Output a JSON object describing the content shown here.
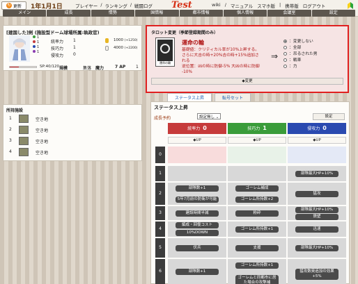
{
  "header": {
    "refresh_label": "更新",
    "date": "1年1月1日",
    "nav_left": [
      "プレイヤー",
      "/",
      "ランキング",
      "/",
      "戦闘ログ"
    ],
    "logo": "Test",
    "nav_right": [
      "wiki",
      "/",
      "マニュアル",
      "スマホ版",
      "|",
      "携帯版",
      "ログアウト"
    ],
    "tabs": [
      "メイン",
      "成長",
      "情勢",
      "国情報",
      "都市情報",
      "個人情報",
      "会議室",
      "設定"
    ]
  },
  "status": {
    "title": "[建国した]剣 (施設型ドーム球場所属:執政官)",
    "orbs": [
      "1",
      "1",
      "1",
      "1"
    ],
    "stats": [
      {
        "label": "統率力",
        "value": "1"
      },
      {
        "label": "技巧力",
        "value": "1"
      },
      {
        "label": "侵攻力",
        "value": "0"
      }
    ],
    "resources": [
      {
        "value": "1000",
        "max": "(+1250)"
      },
      {
        "value": "4000",
        "max": "(+2200)"
      }
    ],
    "sp_text": "SP:40/120",
    "sp_fill": 0.33,
    "bottom": [
      "規模",
      "集落",
      "魔力",
      "7 AP",
      "1"
    ]
  },
  "tarot": {
    "title": "タロット変更（季節登録期間のみ）",
    "card_caption": "運命の輪",
    "name": "運命の輪",
    "desc_lines": [
      "基礎値：クリティカル率が10%上昇する。",
      "さらに大吉の時+20%吉の時+15%追加さ",
      "れる",
      "逆位置：凶の時に防御-5% 大凶の時に防御",
      "-10%"
    ],
    "arrow": "⇒",
    "options": [
      "：変更しない",
      "：全部",
      "：吊るされた男",
      "：戦車",
      "：力"
    ],
    "change_label": "◆変更"
  },
  "facilities": {
    "title": "所持施設",
    "items": [
      {
        "num": "1",
        "label": "空き地"
      },
      {
        "num": "2",
        "label": "空き地"
      },
      {
        "num": "3",
        "label": "空き地"
      },
      {
        "num": "4",
        "label": "空き地"
      }
    ]
  },
  "tabs2": [
    "ステータス上昇",
    "転号セット"
  ],
  "statup": {
    "title": "ステータス上昇",
    "plan_label": "成長予約",
    "plan_value": "設定無し ⌄",
    "plan_button": "設定",
    "columns": [
      {
        "label": "統率力",
        "value": "0",
        "color": "#c63b3b"
      },
      {
        "label": "技巧力",
        "value": "1",
        "color": "#3a9c3a"
      },
      {
        "label": "侵攻力",
        "value": "0",
        "color": "#2a4ab0"
      }
    ],
    "up_label": "◆UP",
    "rows": [
      {
        "num": "0",
        "c1": [],
        "c2": [],
        "c3": []
      },
      {
        "num": "1",
        "c1": [],
        "c2": [],
        "c3": [
          "部隊最大HP+10%"
        ]
      },
      {
        "num": "2",
        "c1": [
          "部隊数+1",
          "5年7月前の防衛が可能"
        ],
        "c2": [
          "ゴーレム補成",
          "ゴーレム所持数+2"
        ],
        "c3": [
          "猛攻"
        ]
      },
      {
        "num": "3",
        "c1": [
          "建設時間半減"
        ],
        "c2": [
          "粉砕"
        ],
        "c3": [
          "部隊最大HP+10%",
          "鉄壁"
        ]
      },
      {
        "num": "4",
        "c1": [
          "編成・回復コスト",
          "10%DOWN"
        ],
        "c2": [
          "ゴーレム所持数+1"
        ],
        "c3": [
          "迅速"
        ]
      },
      {
        "num": "5",
        "c1": [
          "伏兵"
        ],
        "c2": [
          "支援"
        ],
        "c3": [
          "部隊最大HP+10%"
        ]
      },
      {
        "num": "6",
        "c1": [
          "部隊数+1"
        ],
        "c2": [
          "ゴーレム所持数+1",
          "ゴーレムと同都市に居た場合の攻撃補"
        ],
        "c3": [
          "猛攻数奥追加の効果+5%"
        ]
      }
    ]
  }
}
